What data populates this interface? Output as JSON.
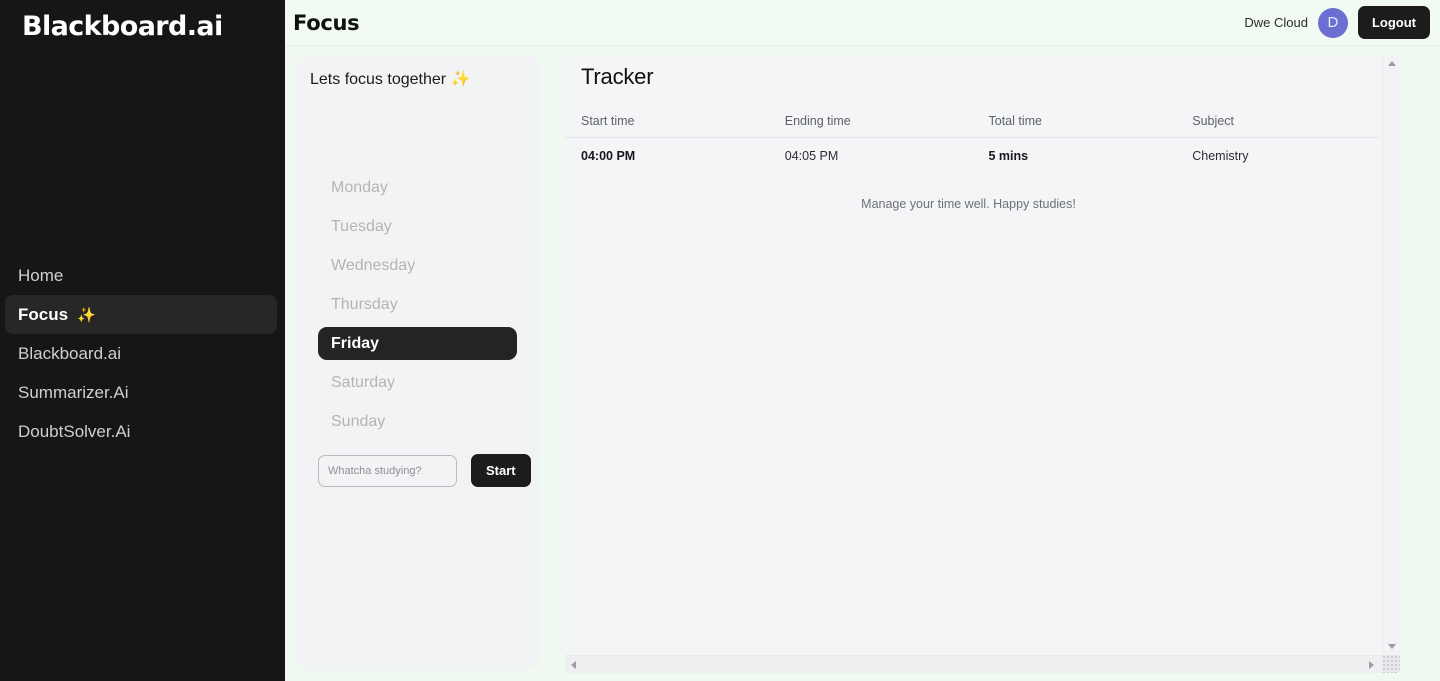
{
  "sidebar": {
    "brand": "Blackboard.ai",
    "items": [
      {
        "label": "Home",
        "active": false,
        "sparkle": ""
      },
      {
        "label": "Focus",
        "active": true,
        "sparkle": "✨"
      },
      {
        "label": "Blackboard.ai",
        "active": false,
        "sparkle": ""
      },
      {
        "label": "Summarizer.Ai",
        "active": false,
        "sparkle": ""
      },
      {
        "label": "DoubtSolver.Ai",
        "active": false,
        "sparkle": ""
      }
    ]
  },
  "topbar": {
    "title": "Focus",
    "username": "Dwe Cloud",
    "avatar_initial": "D",
    "avatar_color": "#6a6fd1",
    "logout_label": "Logout"
  },
  "focus_card": {
    "heading": "Lets focus together ✨",
    "days": [
      {
        "label": "Monday",
        "selected": false
      },
      {
        "label": "Tuesday",
        "selected": false
      },
      {
        "label": "Wednesday",
        "selected": false
      },
      {
        "label": "Thursday",
        "selected": false
      },
      {
        "label": "Friday",
        "selected": true
      },
      {
        "label": "Saturday",
        "selected": false
      },
      {
        "label": "Sunday",
        "selected": false
      }
    ],
    "input_placeholder": "Whatcha studying?",
    "input_value": "",
    "start_label": "Start"
  },
  "tracker": {
    "title": "Tracker",
    "columns": [
      "Start time",
      "Ending time",
      "Total time",
      "Subject"
    ],
    "rows": [
      {
        "start_time": "04:00 PM",
        "ending_time": "04:05 PM",
        "total_time": "5 mins",
        "subject": "Chemistry"
      }
    ],
    "note": "Manage your time well. Happy studies!"
  }
}
